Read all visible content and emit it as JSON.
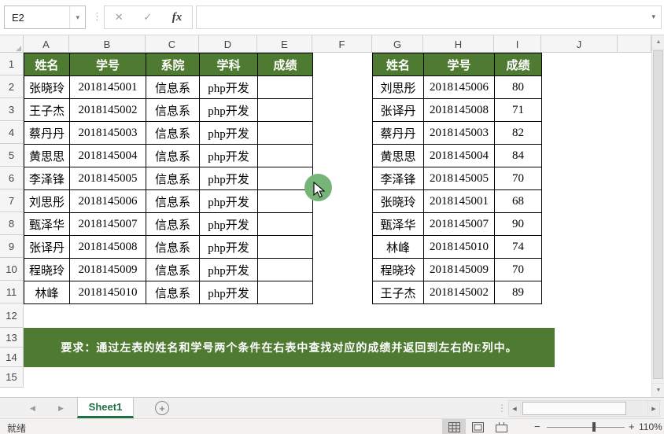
{
  "formula_bar": {
    "name_box": "E2",
    "formula_value": ""
  },
  "icons": {
    "caret_down": "▾",
    "dots_vertical": "⋮",
    "cancel": "✕",
    "check": "✓",
    "fx": "fx",
    "chevron_down": "▾",
    "corner_triangle": "◢",
    "nav_left": "◀",
    "nav_right": "▶",
    "add": "+",
    "scroll_up": "▲",
    "scroll_down": "▼",
    "scroll_left": "◀",
    "scroll_right": "▶",
    "zoom_out": "−",
    "zoom_in": "+"
  },
  "columns": [
    "A",
    "B",
    "C",
    "D",
    "E",
    "F",
    "G",
    "H",
    "I",
    "J"
  ],
  "row_numbers": [
    "1",
    "2",
    "3",
    "4",
    "5",
    "6",
    "7",
    "8",
    "9",
    "10",
    "11",
    "12",
    "13",
    "14",
    "15"
  ],
  "left_table": {
    "headers": [
      "姓名",
      "学号",
      "系院",
      "学科",
      "成绩"
    ],
    "rows": [
      {
        "name": "张晓玲",
        "id": "2018145001",
        "dept": "信息系",
        "subject": "php开发",
        "score": ""
      },
      {
        "name": "王子杰",
        "id": "2018145002",
        "dept": "信息系",
        "subject": "php开发",
        "score": ""
      },
      {
        "name": "蔡丹丹",
        "id": "2018145003",
        "dept": "信息系",
        "subject": "php开发",
        "score": ""
      },
      {
        "name": "黄思思",
        "id": "2018145004",
        "dept": "信息系",
        "subject": "php开发",
        "score": ""
      },
      {
        "name": "李泽锋",
        "id": "2018145005",
        "dept": "信息系",
        "subject": "php开发",
        "score": ""
      },
      {
        "name": "刘思彤",
        "id": "2018145006",
        "dept": "信息系",
        "subject": "php开发",
        "score": ""
      },
      {
        "name": "甄泽华",
        "id": "2018145007",
        "dept": "信息系",
        "subject": "php开发",
        "score": ""
      },
      {
        "name": "张译丹",
        "id": "2018145008",
        "dept": "信息系",
        "subject": "php开发",
        "score": ""
      },
      {
        "name": "程晓玲",
        "id": "2018145009",
        "dept": "信息系",
        "subject": "php开发",
        "score": ""
      },
      {
        "name": "林峰",
        "id": "2018145010",
        "dept": "信息系",
        "subject": "php开发",
        "score": ""
      }
    ]
  },
  "right_table": {
    "headers": [
      "姓名",
      "学号",
      "成绩"
    ],
    "rows": [
      {
        "name": "刘思彤",
        "id": "2018145006",
        "score": "80"
      },
      {
        "name": "张译丹",
        "id": "2018145008",
        "score": "71"
      },
      {
        "name": "蔡丹丹",
        "id": "2018145003",
        "score": "82"
      },
      {
        "name": "黄思思",
        "id": "2018145004",
        "score": "84"
      },
      {
        "name": "李泽锋",
        "id": "2018145005",
        "score": "70"
      },
      {
        "name": "张晓玲",
        "id": "2018145001",
        "score": "68"
      },
      {
        "name": "甄泽华",
        "id": "2018145007",
        "score": "90"
      },
      {
        "name": "林峰",
        "id": "2018145010",
        "score": "74"
      },
      {
        "name": "程晓玲",
        "id": "2018145009",
        "score": "70"
      },
      {
        "name": "王子杰",
        "id": "2018145002",
        "score": "89"
      }
    ]
  },
  "banner": {
    "text": "要求：通过左表的姓名和学号两个条件在右表中查找对应的成绩并返回到左右的E列中。"
  },
  "sheet_bar": {
    "active_tab": "Sheet1"
  },
  "status_bar": {
    "ready": "就绪",
    "zoom": "110%"
  },
  "colors": {
    "table-green": "#4e7b31",
    "accent-green": "#1e7145",
    "cursor-green": "#76b478"
  }
}
